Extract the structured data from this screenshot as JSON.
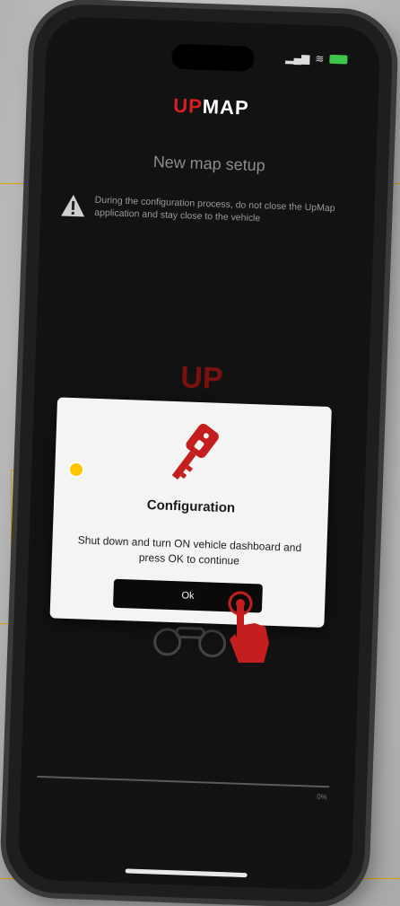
{
  "app": {
    "logo_up": "UP",
    "logo_map": "MAP",
    "screen_title": "New map setup",
    "warning": "During the configuration process, do not close the UpMap application and stay close to the vehicle",
    "progress_label": "0%"
  },
  "dialog": {
    "title": "Configuration",
    "message": "Shut down and turn ON vehicle dashboard and press OK to continue",
    "ok_label": "Ok"
  },
  "status_bar": {
    "icons": [
      "signal-icon",
      "wifi-icon",
      "battery-icon"
    ]
  },
  "colors": {
    "brand_red": "#d32020",
    "callout": "#e0a000",
    "dialog_button": "#0a0a0a"
  },
  "progress": {
    "fraction": 0.0
  }
}
